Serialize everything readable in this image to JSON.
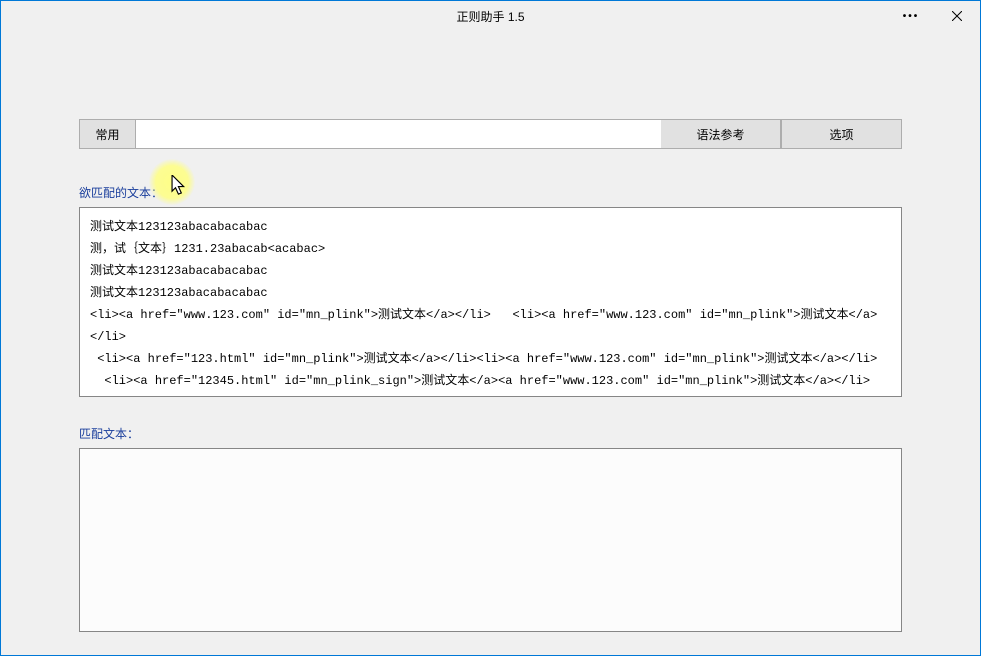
{
  "window": {
    "title": "正则助手 1.5"
  },
  "toolbar": {
    "common_label": "常用",
    "expression_value": "",
    "reference_label": "语法参考",
    "options_label": "选项"
  },
  "labels": {
    "input_label": "欲匹配的文本：",
    "output_label": "匹配文本："
  },
  "input_text": "测试文本123123abacabacabac\n测，试｛文本｝1231.23abacab<acabac>\n测试文本123123abacabacabac\n测试文本123123abacabacabac\n<li><a href=\"www.123.com\" id=\"mn_plink\">测试文本</a></li>   <li><a href=\"www.123.com\" id=\"mn_plink\">测试文本</a></li>\n <li><a href=\"123.html\" id=\"mn_plink\">测试文本</a></li><li><a href=\"www.123.com\" id=\"mn_plink\">测试文本</a></li>\n  <li><a href=\"12345.html\" id=\"mn_plink_sign\">测试文本</a><a href=\"www.123.com\" id=\"mn_plink\">测试文本</a></li>",
  "output_text": ""
}
